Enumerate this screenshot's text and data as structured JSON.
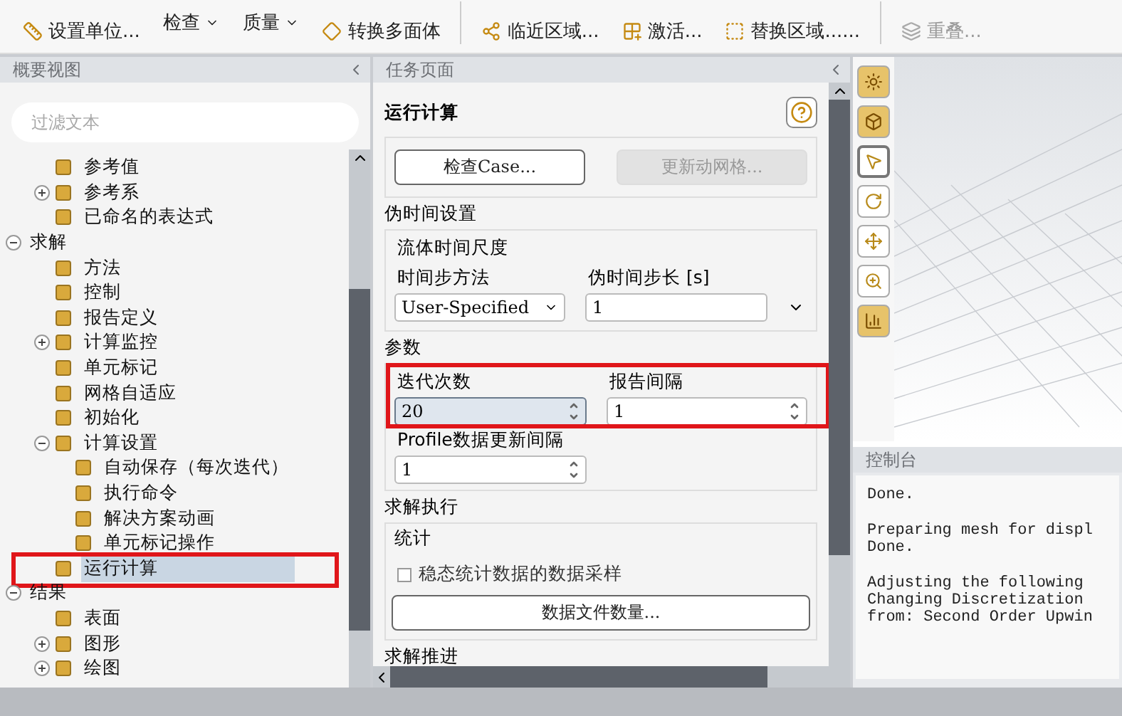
{
  "toolbar": {
    "items": [
      {
        "label": "设置单位...",
        "kind": "small",
        "disabled": false
      },
      {
        "label": "检查",
        "kind": "menu",
        "disabled": false
      },
      {
        "label": "质量",
        "kind": "menu",
        "disabled": false
      },
      {
        "label": "转换多面体",
        "kind": "small",
        "disabled": false
      },
      {
        "label": "临近区域...",
        "kind": "small",
        "disabled": false
      },
      {
        "label": "激活...",
        "kind": "small",
        "disabled": false
      },
      {
        "label": "替换区域......",
        "kind": "small",
        "disabled": false
      },
      {
        "label": "重叠...",
        "kind": "small",
        "disabled": true
      }
    ]
  },
  "outline": {
    "title": "概要视图",
    "filter": {
      "placeholder": "过滤文本"
    },
    "tree": [
      {
        "children": [
          {
            "label": "参考值",
            "selected": false,
            "highlighted": false
          },
          {
            "label": "参考系",
            "selected": false,
            "highlighted": false,
            "expanded": false
          },
          {
            "label": "已命名的表达式",
            "selected": false,
            "highlighted": false
          }
        ]
      },
      {
        "label": "求解",
        "selected": false,
        "highlighted": false,
        "expanded": true,
        "children": [
          {
            "label": "方法",
            "selected": false,
            "highlighted": false
          },
          {
            "label": "控制",
            "selected": false,
            "highlighted": false
          },
          {
            "label": "报告定义",
            "selected": false,
            "highlighted": false
          },
          {
            "label": "计算监控",
            "selected": false,
            "highlighted": false,
            "expanded": false
          },
          {
            "label": "单元标记",
            "selected": false,
            "highlighted": false
          },
          {
            "label": "网格自适应",
            "selected": false,
            "highlighted": false
          },
          {
            "label": "初始化",
            "selected": false,
            "highlighted": false
          },
          {
            "label": "计算设置",
            "selected": false,
            "highlighted": false,
            "expanded": true,
            "children": [
              {
                "label": "自动保存（每次迭代）",
                "selected": false,
                "highlighted": false
              },
              {
                "label": "执行命令",
                "selected": false,
                "highlighted": false
              },
              {
                "label": "解决方案动画",
                "selected": false,
                "highlighted": false
              },
              {
                "label": "单元标记操作",
                "selected": false,
                "highlighted": false
              }
            ]
          },
          {
            "label": "运行计算",
            "selected": true,
            "highlighted": true
          }
        ]
      },
      {
        "label": "结果",
        "selected": false,
        "highlighted": false,
        "expanded": true,
        "children": [
          {
            "label": "表面",
            "selected": false,
            "highlighted": false
          },
          {
            "label": "图形",
            "selected": false,
            "highlighted": false,
            "expanded": false
          },
          {
            "label": "绘图",
            "selected": false,
            "highlighted": false,
            "expanded": false
          }
        ]
      }
    ]
  },
  "task_page": {
    "title": "任务页面",
    "heading": "运行计算",
    "buttons": [
      {
        "label": "检查Case...",
        "disabled": false
      },
      {
        "label": "更新动网格...",
        "disabled": true
      }
    ],
    "pseudo_time": {
      "title": "伪时间设置",
      "group": "流体时间尺度",
      "method": {
        "label": "时间步方法",
        "value": "User-Specified"
      },
      "step": {
        "label": "伪时间步长 [s]",
        "value": "1"
      }
    },
    "parameters": {
      "title": "参数",
      "highlighted": true,
      "iterations": {
        "label": "迭代次数",
        "value": "20",
        "focused": true
      },
      "report_interval": {
        "label": "报告间隔",
        "value": "1",
        "focused": false
      },
      "profile_interval": {
        "label": "Profile数据更新间隔",
        "value": "1",
        "focused": false
      }
    },
    "execution": {
      "title": "求解执行",
      "group": "统计",
      "checkbox": {
        "label": "稳态统计数据的数据采样",
        "checked": false
      },
      "button": "数据文件数量..."
    },
    "advance": {
      "title": "求解推进"
    }
  },
  "view_tools": [
    {
      "kind": "gold",
      "selected": false
    },
    {
      "kind": "gold",
      "selected": false
    },
    {
      "kind": "pointer",
      "selected": true
    },
    {
      "kind": "rotate",
      "selected": false
    },
    {
      "kind": "pan",
      "selected": false
    },
    {
      "kind": "zoom",
      "selected": false
    },
    {
      "kind": "gold",
      "selected": false
    }
  ],
  "console": {
    "title": "控制台",
    "paragraphs": [
      [
        "Done."
      ],
      [
        "Preparing mesh for displ",
        "Done."
      ],
      [
        "Adjusting the following",
        "Changing Discretization",
        "from: Second Order Upwin"
      ]
    ]
  }
}
